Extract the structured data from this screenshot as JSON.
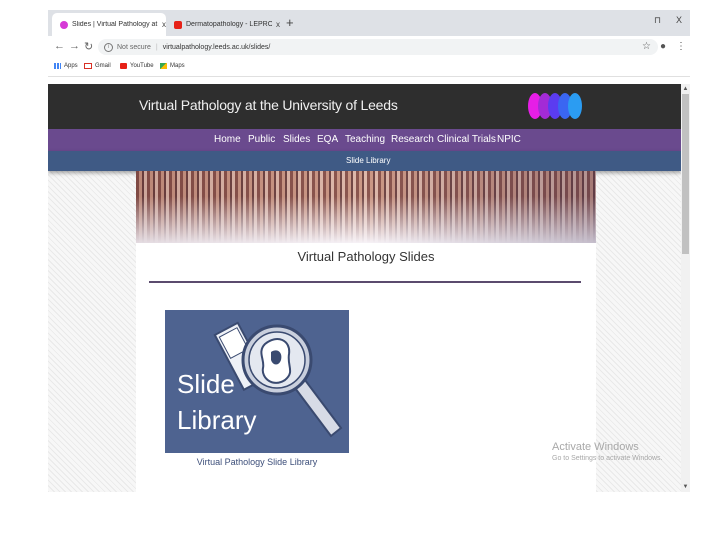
{
  "tabs": [
    {
      "title": "Slides | Virtual Pathology at the U",
      "close": "x",
      "favicon_color": "#d63ad6"
    },
    {
      "title": "Dermatopathology - LEPROSY - ",
      "close": "x",
      "favicon_color": "#e62117"
    }
  ],
  "window_controls": {
    "minimize": "⊓",
    "close": "X"
  },
  "toolbar": {
    "back": "←",
    "forward": "→",
    "reload": "↻",
    "security_label": "Not secure",
    "url": "virtualpathology.leeds.ac.uk/slides/",
    "star": "☆",
    "account": "●",
    "menu": "⋮"
  },
  "bookmarks": [
    {
      "label": "Apps",
      "icon": "apps-icon",
      "color": "#4285f4"
    },
    {
      "label": "Gmail",
      "icon": "gmail-icon",
      "color": "#d93025"
    },
    {
      "label": "YouTube",
      "icon": "youtube-icon",
      "color": "#e62117"
    },
    {
      "label": "Maps",
      "icon": "maps-icon",
      "color": "#34a853"
    }
  ],
  "site": {
    "title": "Virtual Pathology at the University of Leeds",
    "logo_colors": [
      "#e61ee6",
      "#a32bd6",
      "#5b3cf0",
      "#3a66f2",
      "#2b9cf2"
    ]
  },
  "nav": {
    "items": [
      "Home",
      "Public",
      "Slides",
      "EQA",
      "Teaching",
      "Research",
      "Clinical Trials",
      "NPIC"
    ]
  },
  "subnav": {
    "item": "Slide Library"
  },
  "page": {
    "heading": "Virtual Pathology Slides",
    "tile_text": "Slide\nLibrary",
    "tile_caption": "Virtual Pathology Slide Library"
  },
  "watermark": {
    "title": "Activate Windows",
    "subtitle": "Go to Settings to activate Windows."
  }
}
